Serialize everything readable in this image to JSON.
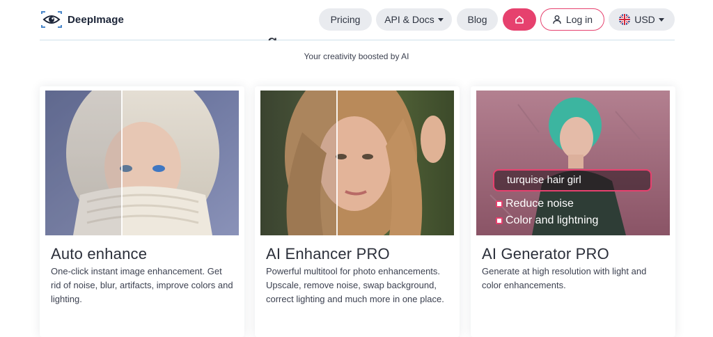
{
  "header": {
    "brand": "DeepImage",
    "nav": {
      "pricing": "Pricing",
      "api_docs": "API & Docs",
      "blog": "Blog",
      "login": "Log in",
      "currency": "USD"
    },
    "accent_color": "#e6416e"
  },
  "hero": {
    "heading_fragment": "g",
    "tagline": "Your creativity boosted by AI"
  },
  "cards": [
    {
      "title": "Auto enhance",
      "description": "One-click instant image enhancement. Get rid of noise, blur, artifacts, improve colors and lighting."
    },
    {
      "title": "AI Enhancer PRO",
      "description": "Powerful multitool for photo enhancements. Upscale, remove noise, swap background, correct lighting and much more in one place."
    },
    {
      "title": "AI Generator PRO",
      "description": "Generate at high resolution with light and color enhancements.",
      "prompt": "turquise hair girl",
      "options": [
        "Reduce noise",
        "Color and lightning"
      ]
    }
  ],
  "icons": {
    "logo": "eye-logo-icon",
    "home": "home-icon",
    "user": "user-icon",
    "flag": "uk-flag-icon",
    "caret": "chevron-down-icon"
  }
}
